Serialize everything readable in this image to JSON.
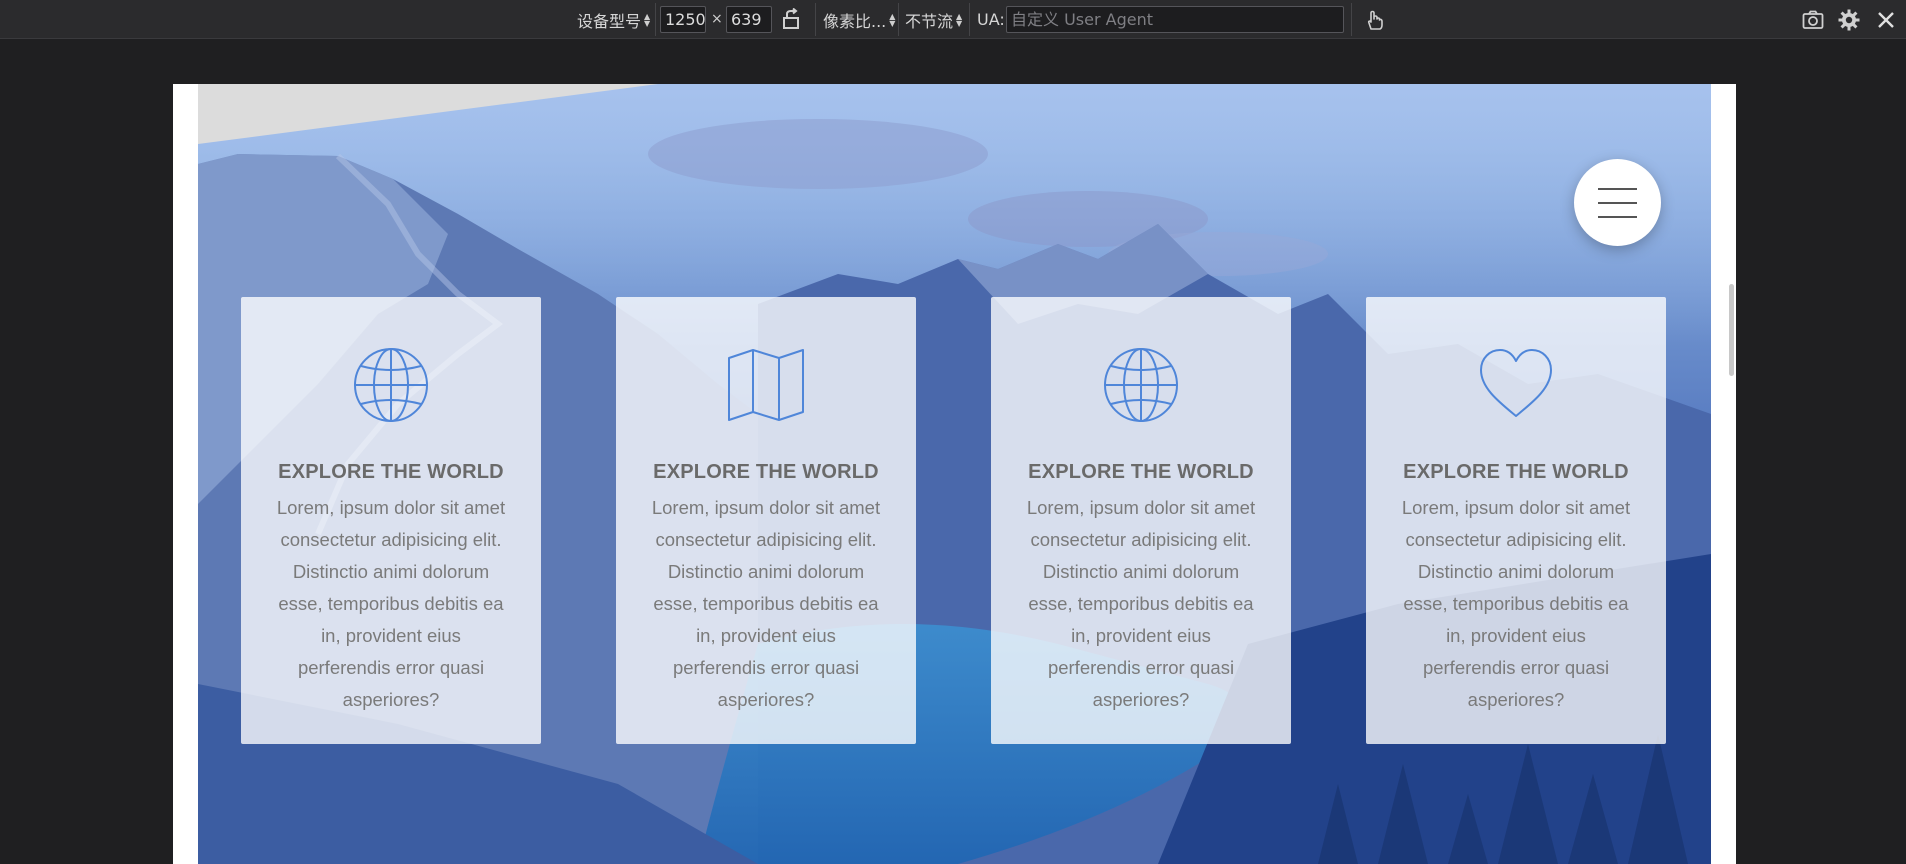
{
  "toolbar": {
    "device_model_label": "设备型号",
    "width_value": "1250",
    "times": "×",
    "height_value": "639",
    "pixel_ratio_label": "像素比...",
    "throttle_label": "不节流",
    "ua_label": "UA:",
    "ua_placeholder": "自定义 User Agent",
    "icons": [
      "rotate-icon",
      "touch-icon",
      "screenshot-icon",
      "settings-icon",
      "close-icon"
    ]
  },
  "page": {
    "menu_icon": "hamburger-menu-icon",
    "cards": [
      {
        "icon": "globe-icon",
        "title": "EXPLORE THE WORLD",
        "text": "Lorem, ipsum dolor sit amet consectetur adipisicing elit. Distinctio animi dolorum esse, temporibus debitis ea in, provident eius perferendis error quasi asperiores?"
      },
      {
        "icon": "map-icon",
        "title": "EXPLORE THE WORLD",
        "text": "Lorem, ipsum dolor sit amet consectetur adipisicing elit. Distinctio animi dolorum esse, temporibus debitis ea in, provident eius perferendis error quasi asperiores?"
      },
      {
        "icon": "globe-icon",
        "title": "EXPLORE THE WORLD",
        "text": "Lorem, ipsum dolor sit amet consectetur adipisicing elit. Distinctio animi dolorum esse, temporibus debitis ea in, provident eius perferendis error quasi asperiores?"
      },
      {
        "icon": "heart-icon",
        "title": "EXPLORE THE WORLD",
        "text": "Lorem, ipsum dolor sit amet consectetur adipisicing elit. Distinctio animi dolorum esse, temporibus debitis ea in, provident eius perferendis error quasi asperiores?"
      }
    ]
  },
  "colors": {
    "icon_accent": "#4f86d9",
    "toolbar_bg": "#2b2b2d",
    "page_bg": "#1f1f21"
  }
}
